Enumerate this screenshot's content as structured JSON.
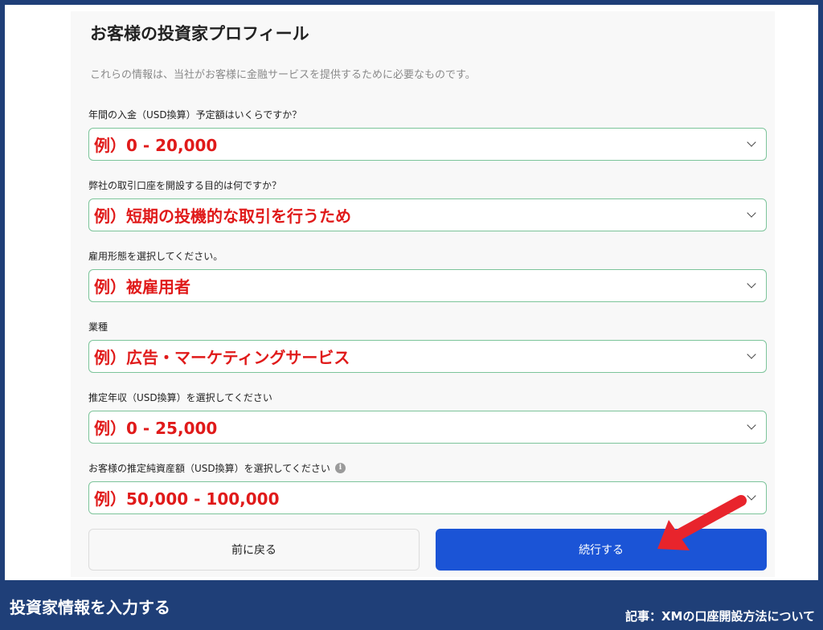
{
  "form": {
    "title": "お客様の投資家プロフィール",
    "description": "これらの情報は、当社がお客様に金融サービスを提供するために必要なものです。",
    "fields": [
      {
        "label": "年間の入金（USD換算）予定額はいくらですか？",
        "value": "例）0 - 20,000"
      },
      {
        "label": "弊社の取引口座を開設する目的は何ですか？",
        "value": "例）短期の投機的な取引を行うため"
      },
      {
        "label": "雇用形態を選択してください。",
        "value": "例）被雇用者"
      },
      {
        "label": "業種",
        "value": "例）広告・マーケティングサービス"
      },
      {
        "label": "推定年収（USD換算）を選択してください",
        "value": "例）0 - 25,000"
      },
      {
        "label": "お客様の推定純資産額（USD換算）を選択してください",
        "value": "例）50,000 - 100,000"
      }
    ],
    "back_label": "前に戻る",
    "next_label": "続行する"
  },
  "caption": {
    "left": "投資家情報を入力する",
    "right": "記事：XMの口座開設方法について"
  },
  "colors": {
    "background": "#1f3f78",
    "accent": "#1b54d6",
    "example_text": "#e01a1a",
    "field_border": "#7cc49a",
    "arrow": "#e8242c"
  },
  "icons": [
    "chevron-down-icon",
    "info-icon",
    "arrow-icon"
  ]
}
